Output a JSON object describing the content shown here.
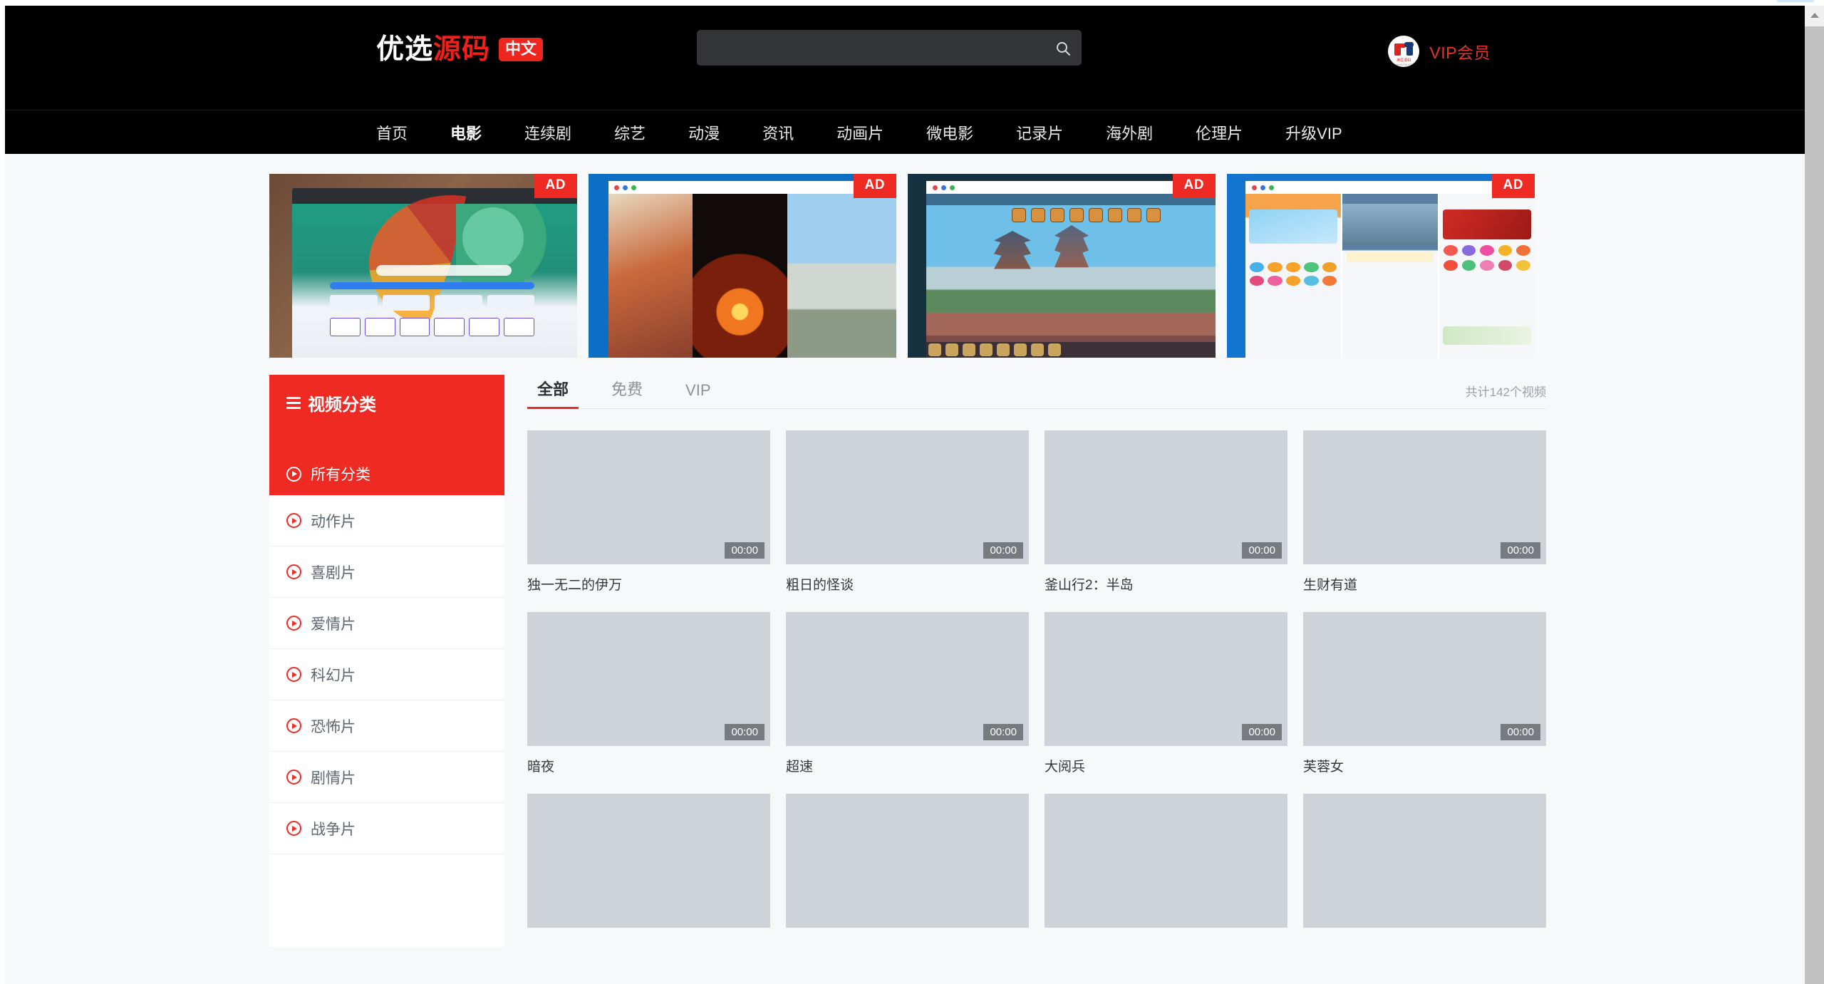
{
  "header": {
    "logo": {
      "white_text": "优选",
      "red_text": "源码",
      "badge": "中文"
    },
    "search": {
      "value": "",
      "placeholder": "",
      "icon": "search-icon"
    },
    "vip": {
      "label": "VIP会员",
      "avatar_caption": "麻豆源码",
      "avatar_sub": "MADOUYM.COM"
    }
  },
  "nav": {
    "items": [
      {
        "label": "首页",
        "active": false
      },
      {
        "label": "电影",
        "active": true
      },
      {
        "label": "连续剧",
        "active": false
      },
      {
        "label": "综艺",
        "active": false
      },
      {
        "label": "动漫",
        "active": false
      },
      {
        "label": "资讯",
        "active": false
      },
      {
        "label": "动画片",
        "active": false
      },
      {
        "label": "微电影",
        "active": false
      },
      {
        "label": "记录片",
        "active": false
      },
      {
        "label": "海外剧",
        "active": false
      },
      {
        "label": "伦理片",
        "active": false
      },
      {
        "label": "升级VIP",
        "active": false
      }
    ]
  },
  "ads": [
    {
      "badge": "AD",
      "name": "ad-banner-knowledge-site"
    },
    {
      "badge": "AD",
      "name": "ad-banner-game-fire"
    },
    {
      "badge": "AD",
      "name": "ad-banner-game-city"
    },
    {
      "badge": "AD",
      "name": "ad-banner-app-mall"
    }
  ],
  "sidebar": {
    "title": "视频分类",
    "title_icon": "list-icon",
    "items": [
      {
        "label": "所有分类",
        "active": true
      },
      {
        "label": "动作片",
        "active": false
      },
      {
        "label": "喜剧片",
        "active": false
      },
      {
        "label": "爱情片",
        "active": false
      },
      {
        "label": "科幻片",
        "active": false
      },
      {
        "label": "恐怖片",
        "active": false
      },
      {
        "label": "剧情片",
        "active": false
      },
      {
        "label": "战争片",
        "active": false
      }
    ]
  },
  "main": {
    "tabs": [
      {
        "label": "全部",
        "active": true
      },
      {
        "label": "免费",
        "active": false
      },
      {
        "label": "VIP",
        "active": false
      }
    ],
    "total_count": "共计142个视频",
    "videos": [
      {
        "title": "独一无二的伊万",
        "duration": "00:00"
      },
      {
        "title": "粗日的怪谈",
        "duration": "00:00"
      },
      {
        "title": "釜山行2：半岛",
        "duration": "00:00"
      },
      {
        "title": "生财有道",
        "duration": "00:00"
      },
      {
        "title": "暗夜",
        "duration": "00:00"
      },
      {
        "title": "超速",
        "duration": "00:00"
      },
      {
        "title": "大阅兵",
        "duration": "00:00"
      },
      {
        "title": "芙蓉女",
        "duration": "00:00"
      },
      {
        "title": "",
        "duration": ""
      },
      {
        "title": "",
        "duration": ""
      },
      {
        "title": "",
        "duration": ""
      },
      {
        "title": "",
        "duration": ""
      }
    ]
  },
  "colors": {
    "brand_red": "#ee2a23",
    "header_black": "#000000",
    "page_bg": "#f7f8fa",
    "thumb_gray": "#ced3da",
    "vip_red": "#e8332a"
  }
}
